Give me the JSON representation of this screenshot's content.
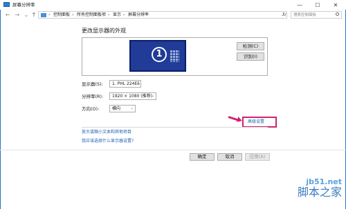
{
  "window": {
    "title": "屏幕分辨率",
    "controls": {
      "minimize": "—",
      "maximize": "☐",
      "close": "✕"
    }
  },
  "address": {
    "breadcrumbs": [
      "控制面板",
      "所有控制面板项",
      "显示",
      "屏幕分辨率"
    ],
    "separator": "›",
    "search_placeholder": "搜索控制面板"
  },
  "content": {
    "page_title": "更改显示器的外观",
    "monitor_number": "1",
    "detect_label": "检测(C)",
    "identify_label": "识别(I)",
    "display_label": "显示器(S):",
    "display_value": "1. PHL 224E5",
    "resolution_label": "分辨率(R):",
    "resolution_value": "1920 × 1080 (推荐)",
    "orientation_label": "方向(O):",
    "orientation_value": "横向",
    "advanced_link": "高级设置",
    "link_text_size": "放大或缩小文本和其他项目",
    "link_which_settings": "我应该选择什么显示器设置?"
  },
  "footer": {
    "ok_label": "确定",
    "cancel_label": "取消",
    "apply_label": "应用(A)"
  },
  "watermark": {
    "site": "jb51.net",
    "brand": "脚本之家"
  },
  "colors": {
    "monitor_fill": "#203c98",
    "highlight": "#d0236f",
    "link": "#1a5fb4"
  }
}
